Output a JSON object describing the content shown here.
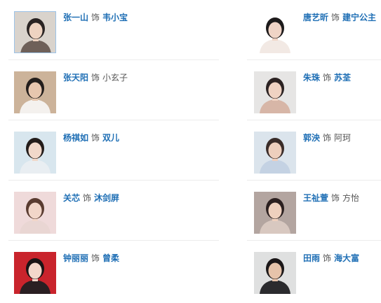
{
  "cast": {
    "as_word": "饰",
    "rows": [
      {
        "left": {
          "actor": "张一山",
          "role": "韦小宝",
          "role_linked": true,
          "photo_bg": "#d9d3cc",
          "photo_fg": "#6e6059",
          "skin": "#eed3c1",
          "hair": "#2a2423",
          "selected": true
        },
        "right": {
          "actor": "唐艺昕",
          "role": "建宁公主",
          "role_linked": true,
          "photo_bg": "#ffffff",
          "photo_fg": "#f2e9e4",
          "skin": "#f0d4c6",
          "hair": "#1d1a1b",
          "selected": false
        }
      },
      {
        "left": {
          "actor": "张天阳",
          "role": "小玄子",
          "role_linked": false,
          "photo_bg": "#ccb39a",
          "photo_fg": "#f4f1ee",
          "skin": "#e7c6ae",
          "hair": "#231e1c",
          "selected": false
        },
        "right": {
          "actor": "朱珠",
          "role": "苏荃",
          "role_linked": true,
          "photo_bg": "#e6e5e4",
          "photo_fg": "#d7b6a7",
          "skin": "#efd2c2",
          "hair": "#2b2222",
          "selected": false
        }
      },
      {
        "left": {
          "actor": "杨祺如",
          "role": "双儿",
          "role_linked": true,
          "photo_bg": "#d8e6ee",
          "photo_fg": "#e9eef2",
          "skin": "#f1d8ca",
          "hair": "#231c1a",
          "selected": false
        },
        "right": {
          "actor": "郭泱",
          "role": "阿珂",
          "role_linked": false,
          "photo_bg": "#dbe4ec",
          "photo_fg": "#c4d2e3",
          "skin": "#eecfbd",
          "hair": "#3a2c29",
          "selected": false
        }
      },
      {
        "left": {
          "actor": "关芯",
          "role": "沐剑屏",
          "role_linked": true,
          "photo_bg": "#efdada",
          "photo_fg": "#e9d6d3",
          "skin": "#f2d6c9",
          "hair": "#5a3c31",
          "selected": false
        },
        "right": {
          "actor": "王祉萱",
          "role": "方怡",
          "role_linked": false,
          "photo_bg": "#b3a5a0",
          "photo_fg": "#d8c8c0",
          "skin": "#eed0be",
          "hair": "#2b2020",
          "selected": false
        }
      },
      {
        "left": {
          "actor": "钟丽丽",
          "role": "曾柔",
          "role_linked": true,
          "photo_bg": "#c9242c",
          "photo_fg": "#2a1f22",
          "skin": "#f3d7ca",
          "hair": "#1a1415",
          "selected": false
        },
        "right": {
          "actor": "田雨",
          "role": "海大富",
          "role_linked": true,
          "photo_bg": "#dfe0e0",
          "photo_fg": "#2b2b2e",
          "skin": "#e6c3aa",
          "hair": "#1c1819",
          "selected": false
        }
      }
    ]
  }
}
